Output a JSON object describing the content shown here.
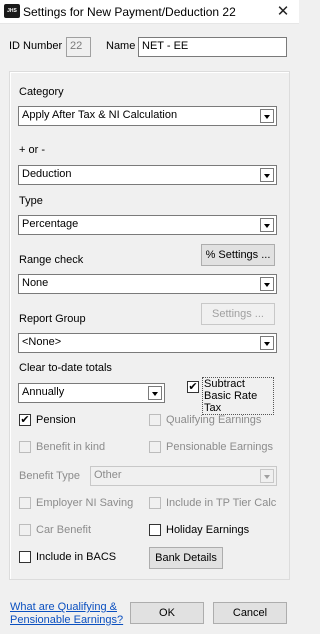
{
  "window": {
    "title": "Settings for New Payment/Deduction  22",
    "icon_text": "JHS",
    "close_glyph": "✕"
  },
  "header": {
    "id_label": "ID Number",
    "id_value": "22",
    "name_label": "Name",
    "name_value": "NET - EE"
  },
  "category": {
    "label": "Category",
    "value": "Apply After Tax & NI Calculation"
  },
  "plus_minus": {
    "label": "+ or -",
    "value": "Deduction"
  },
  "type": {
    "label": "Type",
    "value": "Percentage"
  },
  "range_check": {
    "label": "Range check",
    "value": "None",
    "settings_button": "% Settings ..."
  },
  "report_group": {
    "label": "Report Group",
    "value": "<None>",
    "settings_button": "Settings ..."
  },
  "clear_totals": {
    "label": "Clear to-date totals",
    "value": "Annually"
  },
  "checks": {
    "subtract_basic_rate_tax": {
      "label": "Subtract Basic Rate Tax",
      "checked": true
    },
    "pension": {
      "label": "Pension",
      "checked": true
    },
    "qualifying_earnings": {
      "label": "Qualifying Earnings",
      "checked": false
    },
    "benefit_in_kind": {
      "label": "Benefit in kind",
      "checked": false
    },
    "pensionable_earnings": {
      "label": "Pensionable Earnings",
      "checked": false
    },
    "employer_ni_saving": {
      "label": "Employer NI Saving",
      "checked": false
    },
    "include_tp_tier": {
      "label": "Include in TP Tier Calc",
      "checked": false
    },
    "car_benefit": {
      "label": "Car Benefit",
      "checked": false
    },
    "holiday_earnings": {
      "label": "Holiday Earnings",
      "checked": false
    },
    "include_bacs": {
      "label": "Include in BACS",
      "checked": false
    }
  },
  "benefit_type": {
    "label": "Benefit Type",
    "value": "Other"
  },
  "bank_details_button": "Bank Details",
  "footer": {
    "link_line1": "What are Qualifying &",
    "link_line2": "Pensionable Earnings?",
    "ok": "OK",
    "cancel": "Cancel"
  }
}
